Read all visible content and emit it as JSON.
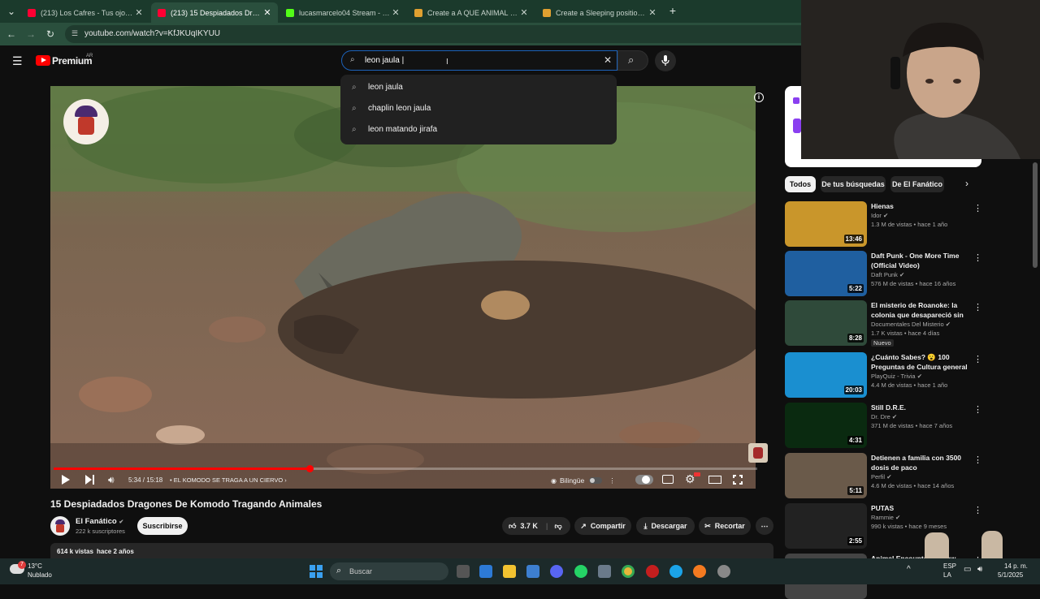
{
  "tabs": [
    {
      "label": "(213) Los Cafres - Tus ojos (AUDIO)",
      "favicon": "youtube-favicon",
      "color": "#ff0033"
    },
    {
      "label": "(213) 15 Despiadados Dragones",
      "favicon": "youtube-favicon",
      "color": "#ff0033",
      "active": true
    },
    {
      "label": "lucasmarcelo04 Stream - Watch",
      "favicon": "kick-favicon",
      "color": "#53fc18"
    },
    {
      "label": "Create a A QUE ANIMAL LE GANA",
      "favicon": "tierlist-favicon",
      "color": "#e0a030"
    },
    {
      "label": "Create a Sleeping positions Ranking",
      "favicon": "tierlist-favicon",
      "color": "#e0a030"
    }
  ],
  "browser": {
    "url": "youtube.com/watch?v=KfJKUqIKYUU",
    "new_tab": "+",
    "tab_close": "✕"
  },
  "youtube": {
    "logo": "Premium",
    "region": "AR",
    "search_value": "leon jaula |",
    "suggestions": [
      "leon jaula",
      "chaplin leon jaula",
      "leon matando jirafa"
    ]
  },
  "video": {
    "time": "5:34 / 15:18",
    "chapter": "• EL KOMODO SE TRAGA A UN CIERVO",
    "progress": 0.364,
    "bilingual_label": "Bilingüe",
    "title": "15 Despiadados Dragones De Komodo Tragando Animales",
    "channel": "El Fanático",
    "subscribers": "222 k suscriptores",
    "subscribe_label": "Suscribirse",
    "likes": "3.7 K",
    "share_label": "Compartir",
    "download_label": "Descargar",
    "clip_label": "Recortar",
    "views": "614 k vistas",
    "published": "hace 2 años"
  },
  "chips": [
    "Todos",
    "De tus búsquedas",
    "De El Fanático"
  ],
  "recommendations": [
    {
      "title": "Hienas",
      "channel": "Idor",
      "meta": "1.3 M de vistas • hace 1 año",
      "duration": "13:46",
      "thumb_color": "#c9962b"
    },
    {
      "title": "Daft Punk - One More Time (Official Video)",
      "channel": "Daft Punk",
      "meta": "576 M de vistas • hace 16 años",
      "duration": "5:22",
      "thumb_color": "#1f5fa0"
    },
    {
      "title": "El misterio de Roanoke: la colonia que desapareció sin ...",
      "channel": "Documentales Del Misterio",
      "meta": "1.7 K vistas • hace 4 días",
      "duration": "8:28",
      "badge": "Nuevo",
      "thumb_color": "#2f4a3a"
    },
    {
      "title": "¿Cuánto Sabes? 😮 100 Preguntas de Cultura general ...",
      "channel": "PlayQuiz - Trivia",
      "meta": "4.4 M de vistas • hace 1 año",
      "duration": "20:03",
      "thumb_color": "#1a8fd0"
    },
    {
      "title": "Still D.R.E.",
      "channel": "Dr. Dre",
      "meta": "371 M de vistas • hace 7 años",
      "duration": "4:31",
      "thumb_color": "#0a2a10"
    },
    {
      "title": "Detienen a familia con 3500 dosis de paco",
      "channel": "Perfil",
      "meta": "4.6 M de vistas • hace 14 años",
      "duration": "5:11",
      "thumb_color": "#6a5a4a"
    },
    {
      "title": "PUTAS",
      "channel": "Rammie",
      "meta": "990 k vistas • hace 9 meses",
      "duration": "2:55",
      "thumb_color": "#222222"
    },
    {
      "title": "Animal Encounter... Chew Get",
      "channel": "",
      "meta": "",
      "duration": "",
      "thumb_color": "#444444"
    }
  ],
  "taskbar": {
    "weather_temp": "13°C",
    "weather_desc": "Nublado",
    "weather_badge": "7",
    "search_placeholder": "Buscar",
    "lang": "ESP",
    "lang2": "LA",
    "time": "14 p. m.",
    "date": "5/1/2025"
  }
}
